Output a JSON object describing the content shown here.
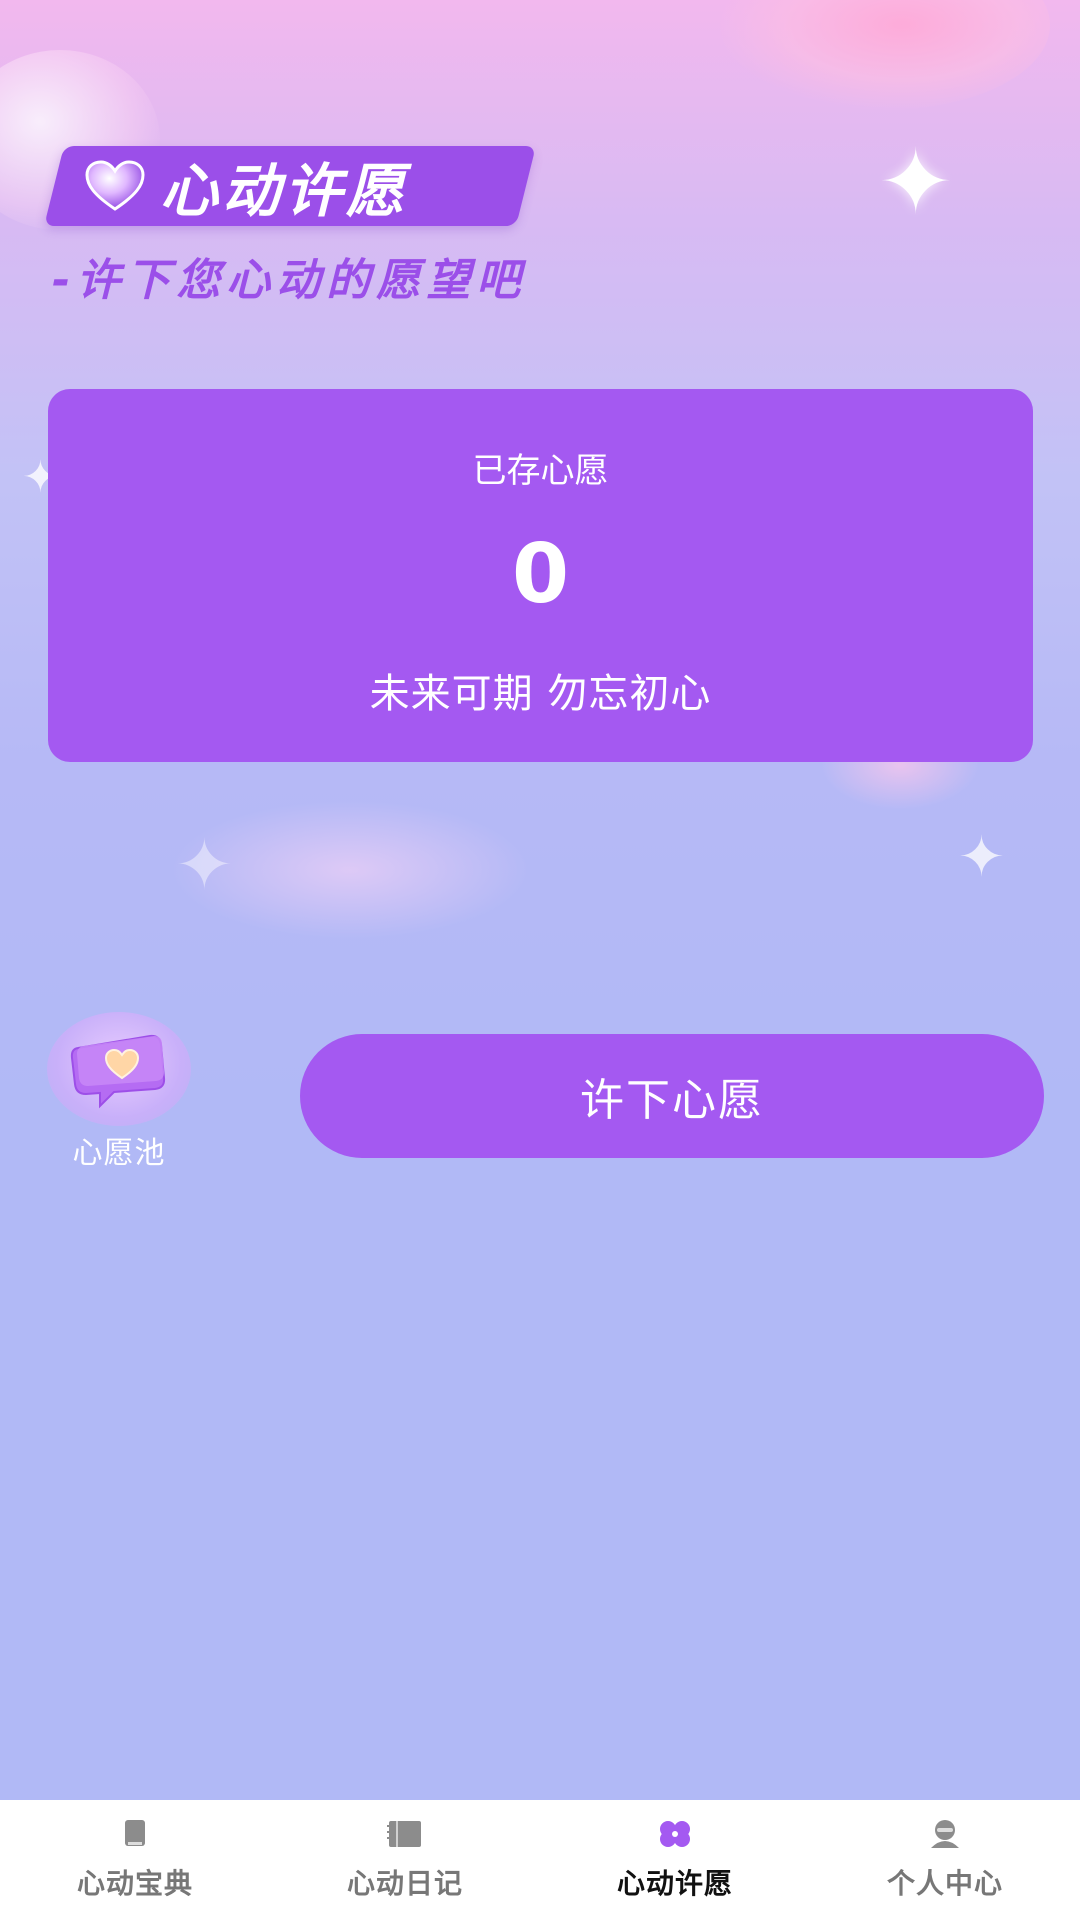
{
  "header": {
    "title": "心动许愿",
    "subtitle": "-许下您心动的愿望吧"
  },
  "stats_card": {
    "label": "已存心愿",
    "count": "0",
    "slogan": "未来可期 勿忘初心"
  },
  "wish_pool": {
    "label": "心愿池",
    "icon": "heart-chat-bubble-icon"
  },
  "make_wish_button": {
    "label": "许下心愿"
  },
  "bottom_nav": {
    "active_index": 2,
    "items": [
      {
        "label": "心动宝典",
        "icon": "book-icon"
      },
      {
        "label": "心动日记",
        "icon": "notebook-icon"
      },
      {
        "label": "心动许愿",
        "icon": "clover-icon"
      },
      {
        "label": "个人中心",
        "icon": "person-icon"
      }
    ]
  },
  "colors": {
    "primary": "#a459f1",
    "badge": "#9b4fe9",
    "nav_background": "#ffffff",
    "nav_inactive": "#777777",
    "nav_active": "#111111"
  }
}
